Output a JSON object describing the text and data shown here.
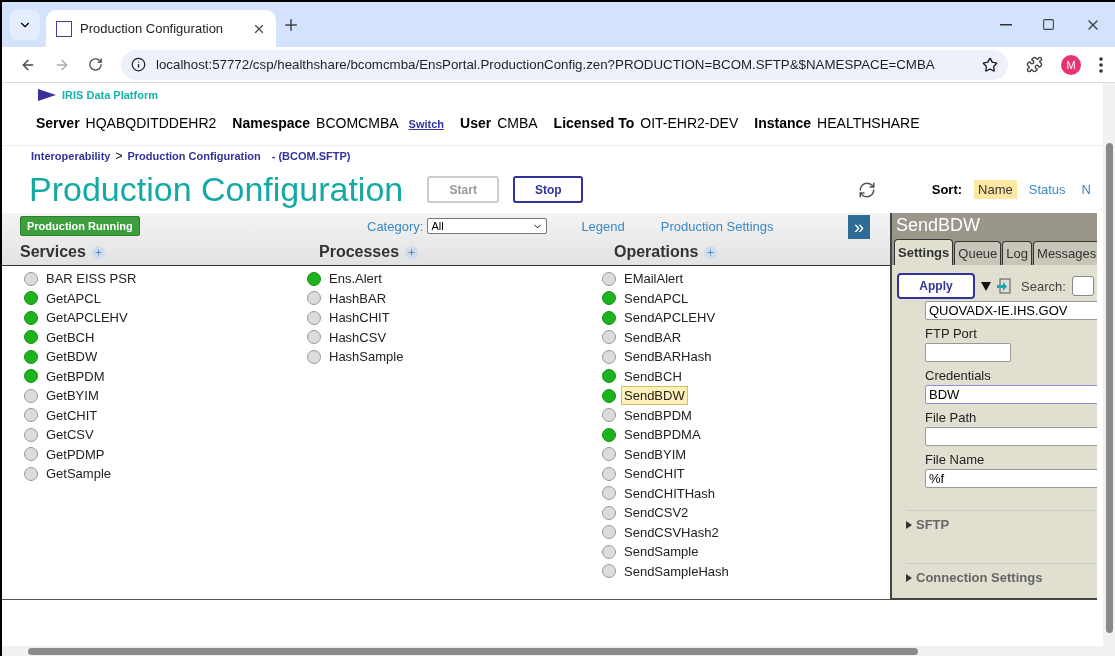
{
  "browser": {
    "tab_title": "Production Configuration",
    "url": "localhost:57772/csp/healthshare/bcomcmba/EnsPortal.ProductionConfig.zen?PRODUCTION=BCOM.SFTP&$NAMESPACE=CMBA",
    "avatar": "M"
  },
  "header": {
    "logo": "IRIS Data Platform",
    "info": [
      {
        "label": "Server",
        "value": "HQABQDITDDEHR2"
      },
      {
        "label": "Namespace",
        "value": "BCOMCMBA",
        "link": "Switch"
      },
      {
        "label": "User",
        "value": "CMBA"
      },
      {
        "label": "Licensed To",
        "value": "OIT-EHR2-DEV"
      },
      {
        "label": "Instance",
        "value": "HEALTHSHARE"
      }
    ]
  },
  "breadcrumb": {
    "items": [
      "Interoperability",
      "Production Configuration"
    ],
    "separator": ">",
    "production": "- (BCOM.SFTP)"
  },
  "title": "Production Configuration",
  "buttons": [
    {
      "label": "Start",
      "disabled": true
    },
    {
      "label": "Stop",
      "disabled": false
    }
  ],
  "sort": {
    "label": "Sort:",
    "options": [
      {
        "label": "Name",
        "selected": true
      },
      {
        "label": "Status",
        "selected": false
      },
      {
        "label": "N",
        "selected": false
      }
    ]
  },
  "toolbar": {
    "status": "Production Running",
    "category_label": "Category:",
    "category_value": "All",
    "links": [
      "Legend",
      "Production Settings"
    ],
    "expand": "»"
  },
  "columns": [
    {
      "title": "Services",
      "items": [
        {
          "name": "BAR EISS PSR",
          "running": false,
          "selected": false
        },
        {
          "name": "GetAPCL",
          "running": true,
          "selected": false
        },
        {
          "name": "GetAPCLEHV",
          "running": true,
          "selected": false
        },
        {
          "name": "GetBCH",
          "running": true,
          "selected": false
        },
        {
          "name": "GetBDW",
          "running": true,
          "selected": false
        },
        {
          "name": "GetBPDM",
          "running": true,
          "selected": false
        },
        {
          "name": "GetBYIM",
          "running": false,
          "selected": false
        },
        {
          "name": "GetCHIT",
          "running": false,
          "selected": false
        },
        {
          "name": "GetCSV",
          "running": false,
          "selected": false
        },
        {
          "name": "GetPDMP",
          "running": false,
          "selected": false
        },
        {
          "name": "GetSample",
          "running": false,
          "selected": false
        }
      ]
    },
    {
      "title": "Processes",
      "items": [
        {
          "name": "Ens.Alert",
          "running": true,
          "selected": false
        },
        {
          "name": "HashBAR",
          "running": false,
          "selected": false
        },
        {
          "name": "HashCHIT",
          "running": false,
          "selected": false
        },
        {
          "name": "HashCSV",
          "running": false,
          "selected": false
        },
        {
          "name": "HashSample",
          "running": false,
          "selected": false
        }
      ]
    },
    {
      "title": "Operations",
      "items": [
        {
          "name": "EMailAlert",
          "running": false,
          "selected": false
        },
        {
          "name": "SendAPCL",
          "running": true,
          "selected": false
        },
        {
          "name": "SendAPCLEHV",
          "running": true,
          "selected": false
        },
        {
          "name": "SendBAR",
          "running": false,
          "selected": false
        },
        {
          "name": "SendBARHash",
          "running": false,
          "selected": false
        },
        {
          "name": "SendBCH",
          "running": true,
          "selected": false
        },
        {
          "name": "SendBDW",
          "running": true,
          "selected": true
        },
        {
          "name": "SendBPDM",
          "running": false,
          "selected": false
        },
        {
          "name": "SendBPDMA",
          "running": true,
          "selected": false
        },
        {
          "name": "SendBYIM",
          "running": false,
          "selected": false
        },
        {
          "name": "SendCHIT",
          "running": false,
          "selected": false
        },
        {
          "name": "SendCHITHash",
          "running": false,
          "selected": false
        },
        {
          "name": "SendCSV2",
          "running": false,
          "selected": false
        },
        {
          "name": "SendCSVHash2",
          "running": false,
          "selected": false
        },
        {
          "name": "SendSample",
          "running": false,
          "selected": false
        },
        {
          "name": "SendSampleHash",
          "running": false,
          "selected": false
        }
      ]
    }
  ],
  "panel": {
    "title": "SendBDW",
    "tabs": [
      {
        "label": "Settings",
        "selected": true
      },
      {
        "label": "Queue",
        "selected": false
      },
      {
        "label": "Log",
        "selected": false
      },
      {
        "label": "Messages",
        "selected": false
      }
    ],
    "apply": "Apply",
    "search_label": "Search:",
    "fields": [
      {
        "value": "QUOVADX-IE.IHS.GOV",
        "short": false,
        "focused": false
      },
      {
        "label": "FTP Port",
        "short": true,
        "focused": false
      },
      {
        "label": "Credentials",
        "value": "BDW",
        "short": false,
        "focused": true
      },
      {
        "label": "File Path",
        "short": false,
        "focused": false
      },
      {
        "label": "File Name",
        "value": "%f",
        "short": false,
        "focused": false
      }
    ],
    "sections": [
      {
        "label": "SFTP",
        "expanded": false
      },
      {
        "label": "Connection Settings",
        "expanded": false
      }
    ]
  }
}
